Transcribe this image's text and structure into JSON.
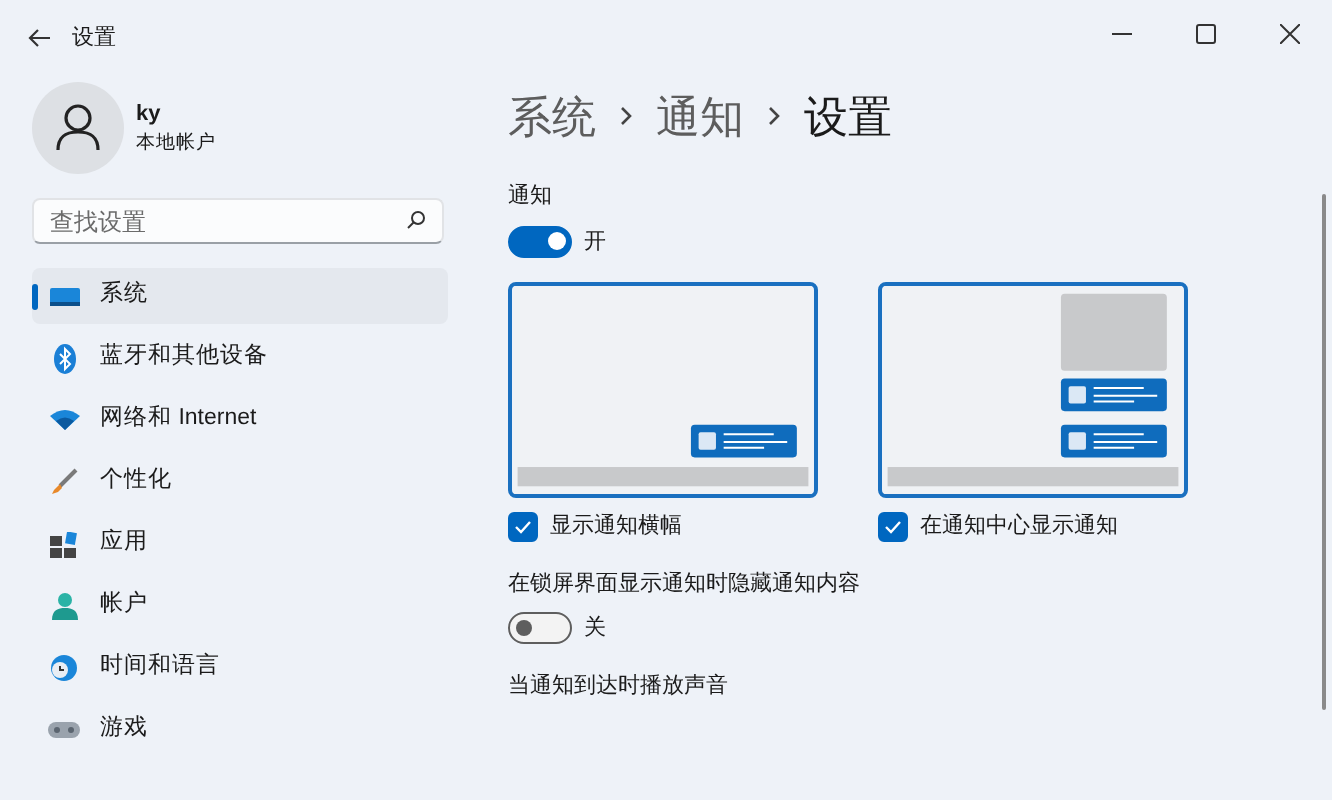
{
  "window": {
    "title": "设置"
  },
  "account": {
    "name": "ky",
    "type": "本地帐户"
  },
  "search": {
    "placeholder": "查找设置"
  },
  "nav": [
    {
      "label": "系统",
      "kind": "system",
      "selected": true
    },
    {
      "label": "蓝牙和其他设备",
      "kind": "bluetooth",
      "selected": false
    },
    {
      "label": "网络和 Internet",
      "kind": "network",
      "selected": false
    },
    {
      "label": "个性化",
      "kind": "personalize",
      "selected": false
    },
    {
      "label": "应用",
      "kind": "apps",
      "selected": false
    },
    {
      "label": "帐户",
      "kind": "account",
      "selected": false
    },
    {
      "label": "时间和语言",
      "kind": "time",
      "selected": false
    },
    {
      "label": "游戏",
      "kind": "gaming",
      "selected": false
    }
  ],
  "breadcrumb": [
    {
      "label": "系统",
      "current": false
    },
    {
      "label": "通知",
      "current": false
    },
    {
      "label": "设置",
      "current": true
    }
  ],
  "notifications": {
    "label": "通知",
    "on": true,
    "state": "开"
  },
  "options": [
    {
      "kind": "banner",
      "label": "显示通知横幅",
      "checked": true
    },
    {
      "kind": "center",
      "label": "在通知中心显示通知",
      "checked": true
    }
  ],
  "settings": [
    {
      "label": "在锁屏界面显示通知时隐藏通知内容",
      "on": false,
      "state": "关"
    },
    {
      "label": "当通知到达时播放声音"
    }
  ]
}
